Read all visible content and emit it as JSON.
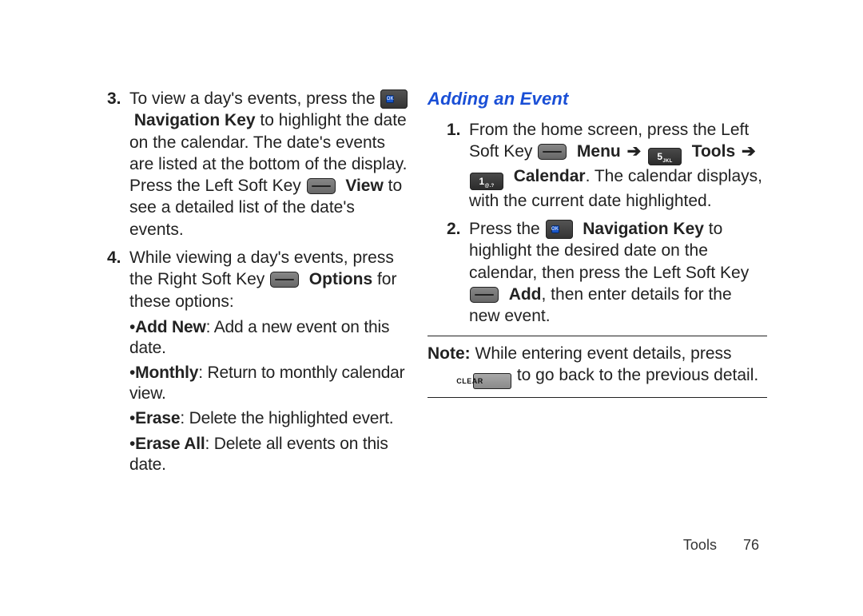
{
  "left": {
    "step3": {
      "num": "3.",
      "t1": "To view a day's events, press the ",
      "nav_key_bold": "Navigation Key",
      "t2": " to highlight the date on the calendar. The date's events are listed at the bottom of the display. Press the Left Soft Key ",
      "view_bold": "View",
      "t3": " to see a detailed list of the date's events."
    },
    "step4": {
      "num": "4.",
      "t1": "While viewing a day's events, press the Right Soft Key ",
      "options_bold": "Options",
      "t2": " for these options:",
      "bullets": [
        {
          "prefix": "•",
          "bold": "Add New",
          "rest": ": Add a new event on this date."
        },
        {
          "prefix": "•",
          "bold": "Monthly",
          "rest": ": Return to monthly calendar view."
        },
        {
          "prefix": "•",
          "bold": "Erase",
          "rest": ": Delete the highlighted evert."
        },
        {
          "prefix": "•",
          "bold": "Erase All",
          "rest": ": Delete all events on this date."
        }
      ]
    }
  },
  "right": {
    "heading": "Adding an Event",
    "step1": {
      "num": "1.",
      "t1": "From the home screen, press the Left Soft Key ",
      "menu_bold": "Menu",
      "arrow": " ➔ ",
      "key5_label": "5 JKL",
      "tools_bold": "Tools",
      "key1_label": "1 @.?",
      "calendar_bold": "Calendar",
      "t2": ". The calendar displays, with the current date highlighted."
    },
    "step2": {
      "num": "2.",
      "t1": "Press the ",
      "nav_key_bold": "Navigation Key",
      "t2": " to highlight the desired date on the calendar, then press the Left Soft Key ",
      "add_bold": "Add",
      "t3": ", then enter details for the new event."
    },
    "note": {
      "label": "Note:",
      "t1": " While entering event details, press ",
      "clear_label": "CLEAR",
      "t2": " to go back to the previous detail."
    }
  },
  "footer": {
    "section": "Tools",
    "page": "76"
  }
}
